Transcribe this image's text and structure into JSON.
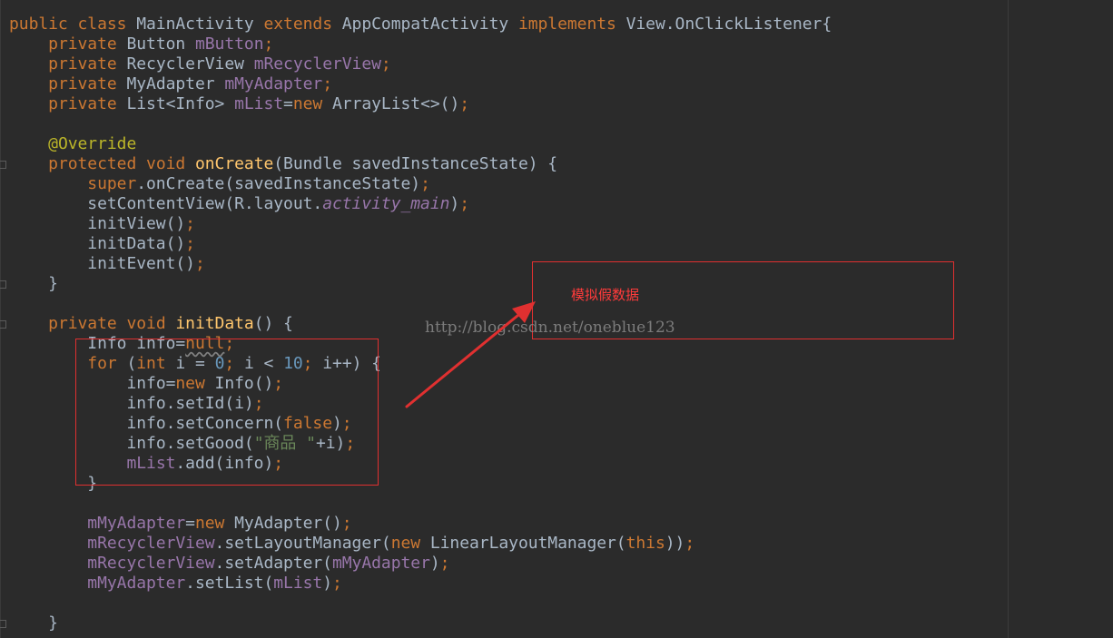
{
  "code": {
    "l1": {
      "kw1": "public class ",
      "cls": "MainActivity ",
      "kw2": "extends ",
      "base": "AppCompatActivity ",
      "kw3": "implements ",
      "iface": "View.OnClickListener{"
    },
    "l2": {
      "kw": "private ",
      "type": "Button ",
      "field": "mButton",
      "semi": ";"
    },
    "l3": {
      "kw": "private ",
      "type": "RecyclerView ",
      "field": "mRecyclerView",
      "semi": ";"
    },
    "l4": {
      "kw": "private ",
      "type": "MyAdapter ",
      "field": "mMyAdapter",
      "semi": ";"
    },
    "l5": {
      "kw": "private ",
      "type": "List<Info> ",
      "field": "mList",
      "eq": "=",
      "new": "new ",
      "rest": "ArrayList<>()",
      "semi": ";"
    },
    "l7": {
      "ann": "@Override"
    },
    "l8": {
      "kw1": "protected ",
      "kw2": "void ",
      "method": "onCreate",
      "rest": "(Bundle savedInstanceState) {"
    },
    "l9": {
      "kw": "super",
      "rest": ".onCreate(savedInstanceState)",
      "semi": ";"
    },
    "l10": {
      "pre": "setContentView(R.layout.",
      "ital": "activity_main",
      "post": ")",
      "semi": ";"
    },
    "l11": {
      "text": "initView()",
      "semi": ";"
    },
    "l12": {
      "text": "initData()",
      "semi": ";"
    },
    "l13": {
      "text": "initEvent()",
      "semi": ";"
    },
    "l14": {
      "text": "}"
    },
    "l16": {
      "kw1": "private ",
      "kw2": "void ",
      "method": "initData",
      "rest": "() {"
    },
    "l17": {
      "pre": "Info info=",
      "null": "null",
      "semi": ";"
    },
    "l18": {
      "kw1": "for ",
      "p1": "(",
      "kw2": "int ",
      "p2": "i = ",
      "n1": "0",
      "s1": "; ",
      "p3": "i < ",
      "n2": "10",
      "s2": "; ",
      "p4": "i++) {"
    },
    "l19": {
      "pre": "info=",
      "new": "new ",
      "rest": "Info()",
      "semi": ";"
    },
    "l20": {
      "text": "info.setId(i)",
      "semi": ";"
    },
    "l21": {
      "pre": "info.setConcern(",
      "kw": "false",
      "post": ")",
      "semi": ";"
    },
    "l22": {
      "pre": "info.setGood(",
      "str": "\"商品 \"",
      "post": "+i)",
      "semi": ";"
    },
    "l23": {
      "field": "mList",
      "rest": ".add(info)",
      "semi": ";"
    },
    "l24": {
      "text": "}"
    },
    "l26": {
      "field": "mMyAdapter",
      "eq": "=",
      "new": "new ",
      "rest": "MyAdapter()",
      "semi": ";"
    },
    "l27": {
      "field": "mRecyclerView",
      "pre": ".setLayoutManager(",
      "new": "new ",
      "mid": "LinearLayoutManager(",
      "this": "this",
      "post": "))",
      "semi": ";"
    },
    "l28": {
      "field": "mRecyclerView",
      "pre": ".setAdapter(",
      "arg": "mMyAdapter",
      "post": ")",
      "semi": ";"
    },
    "l29": {
      "field": "mMyAdapter",
      "pre": ".setList(",
      "arg": "mList",
      "post": ")",
      "semi": ";"
    },
    "l31": {
      "text": "}"
    }
  },
  "annotation": {
    "note": "模拟假数据",
    "watermark": "http://blog.csdn.net/oneblue123",
    "color": "#e03030"
  },
  "theme": {
    "background": "#2b2b2b",
    "keyword": "#cc7832",
    "field": "#9876aa",
    "method": "#ffc66d",
    "annotation": "#bbb529",
    "number": "#6897bb",
    "string": "#6a8759",
    "text": "#a9b7c6"
  }
}
